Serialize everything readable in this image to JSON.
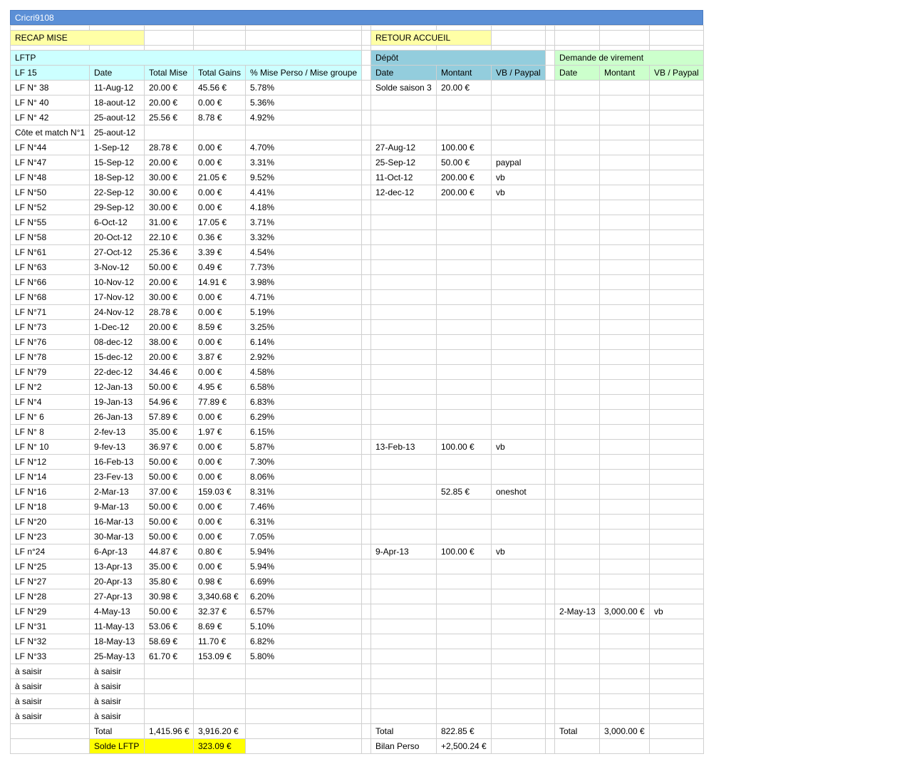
{
  "title": "Cricri9108",
  "links": {
    "recap": "RECAP MISE",
    "retour": "RETOUR ACCUEIL"
  },
  "sections": {
    "lftp": "LFTP",
    "depot": "Dépôt",
    "virement": "Demande de virement"
  },
  "headers": {
    "lftp": [
      "LF 15",
      "Date",
      "Total Mise",
      "Total Gains",
      "% Mise Perso / Mise groupe"
    ],
    "depot": [
      "Date",
      "Montant",
      "VB / Paypal"
    ],
    "virement": [
      "Date",
      "Montant",
      "VB / Paypal"
    ]
  },
  "rows": [
    {
      "lf": "LF N° 38",
      "date": "11-Aug-12",
      "mise": "20.00 €",
      "gains": "45.56 €",
      "pct": "5.78%",
      "d_date": "Solde saison 3",
      "d_mont": "20.00 €",
      "d_vb": "",
      "v_date": "",
      "v_mont": "",
      "v_vb": ""
    },
    {
      "lf": "LF N° 40",
      "date": "18-aout-12",
      "mise": "20.00 €",
      "gains": "0.00 €",
      "pct": "5.36%",
      "d_date": "",
      "d_mont": "",
      "d_vb": "",
      "v_date": "",
      "v_mont": "",
      "v_vb": ""
    },
    {
      "lf": "LF N° 42",
      "date": "25-aout-12",
      "mise": "25.56 €",
      "gains": "8.78 €",
      "pct": "4.92%",
      "d_date": "",
      "d_mont": "",
      "d_vb": "",
      "v_date": "",
      "v_mont": "",
      "v_vb": ""
    },
    {
      "lf": "Côte et match N°1",
      "date": "25-aout-12",
      "mise": "",
      "gains": "",
      "pct": "",
      "d_date": "",
      "d_mont": "",
      "d_vb": "",
      "v_date": "",
      "v_mont": "",
      "v_vb": ""
    },
    {
      "lf": "LF N°44",
      "date": "1-Sep-12",
      "mise": "28.78 €",
      "gains": "0.00 €",
      "pct": "4.70%",
      "d_date": "27-Aug-12",
      "d_mont": "100.00 €",
      "d_vb": "",
      "v_date": "",
      "v_mont": "",
      "v_vb": ""
    },
    {
      "lf": "LF N°47",
      "date": "15-Sep-12",
      "mise": "20.00 €",
      "gains": "0.00 €",
      "pct": "3.31%",
      "d_date": "25-Sep-12",
      "d_mont": "50.00 €",
      "d_vb": "paypal",
      "v_date": "",
      "v_mont": "",
      "v_vb": ""
    },
    {
      "lf": "LF N°48",
      "date": "18-Sep-12",
      "mise": "30.00 €",
      "gains": "21.05 €",
      "pct": "9.52%",
      "d_date": "11-Oct-12",
      "d_mont": "200.00 €",
      "d_vb": "vb",
      "v_date": "",
      "v_mont": "",
      "v_vb": ""
    },
    {
      "lf": "LF N°50",
      "date": "22-Sep-12",
      "mise": "30.00 €",
      "gains": "0.00 €",
      "pct": "4.41%",
      "d_date": "12-dec-12",
      "d_mont": "200.00 €",
      "d_vb": "vb",
      "v_date": "",
      "v_mont": "",
      "v_vb": ""
    },
    {
      "lf": "LF N°52",
      "date": "29-Sep-12",
      "mise": "30.00 €",
      "gains": "0.00 €",
      "pct": "4.18%",
      "d_date": "",
      "d_mont": "",
      "d_vb": "",
      "v_date": "",
      "v_mont": "",
      "v_vb": ""
    },
    {
      "lf": "LF N°55",
      "date": "6-Oct-12",
      "mise": "31.00 €",
      "gains": "17.05 €",
      "pct": "3.71%",
      "d_date": "",
      "d_mont": "",
      "d_vb": "",
      "v_date": "",
      "v_mont": "",
      "v_vb": ""
    },
    {
      "lf": "LF N°58",
      "date": "20-Oct-12",
      "mise": "22.10 €",
      "gains": "0.36 €",
      "pct": "3.32%",
      "d_date": "",
      "d_mont": "",
      "d_vb": "",
      "v_date": "",
      "v_mont": "",
      "v_vb": ""
    },
    {
      "lf": "LF N°61",
      "date": "27-Oct-12",
      "mise": "25.36 €",
      "gains": "3.39 €",
      "pct": "4.54%",
      "d_date": "",
      "d_mont": "",
      "d_vb": "",
      "v_date": "",
      "v_mont": "",
      "v_vb": ""
    },
    {
      "lf": "LF N°63",
      "date": "3-Nov-12",
      "mise": "50.00 €",
      "gains": "0.49 €",
      "pct": "7.73%",
      "d_date": "",
      "d_mont": "",
      "d_vb": "",
      "v_date": "",
      "v_mont": "",
      "v_vb": ""
    },
    {
      "lf": "LF N°66",
      "date": "10-Nov-12",
      "mise": "20.00 €",
      "gains": "14.91 €",
      "pct": "3.98%",
      "d_date": "",
      "d_mont": "",
      "d_vb": "",
      "v_date": "",
      "v_mont": "",
      "v_vb": ""
    },
    {
      "lf": "LF N°68",
      "date": "17-Nov-12",
      "mise": "30.00 €",
      "gains": "0.00 €",
      "pct": "4.71%",
      "d_date": "",
      "d_mont": "",
      "d_vb": "",
      "v_date": "",
      "v_mont": "",
      "v_vb": ""
    },
    {
      "lf": "LF N°71",
      "date": "24-Nov-12",
      "mise": "28.78 €",
      "gains": "0.00 €",
      "pct": "5.19%",
      "d_date": "",
      "d_mont": "",
      "d_vb": "",
      "v_date": "",
      "v_mont": "",
      "v_vb": ""
    },
    {
      "lf": "LF N°73",
      "date": "1-Dec-12",
      "mise": "20.00 €",
      "gains": "8.59 €",
      "pct": "3.25%",
      "d_date": "",
      "d_mont": "",
      "d_vb": "",
      "v_date": "",
      "v_mont": "",
      "v_vb": ""
    },
    {
      "lf": "LF N°76",
      "date": "08-dec-12",
      "mise": "38.00 €",
      "gains": "0.00 €",
      "pct": "6.14%",
      "d_date": "",
      "d_mont": "",
      "d_vb": "",
      "v_date": "",
      "v_mont": "",
      "v_vb": ""
    },
    {
      "lf": "LF N°78",
      "date": "15-dec-12",
      "mise": "20.00 €",
      "gains": "3.87 €",
      "pct": "2.92%",
      "d_date": "",
      "d_mont": "",
      "d_vb": "",
      "v_date": "",
      "v_mont": "",
      "v_vb": ""
    },
    {
      "lf": "LF N°79",
      "date": "22-dec-12",
      "mise": "34.46 €",
      "gains": "0.00 €",
      "pct": "4.58%",
      "d_date": "",
      "d_mont": "",
      "d_vb": "",
      "v_date": "",
      "v_mont": "",
      "v_vb": ""
    },
    {
      "lf": "LF N°2",
      "date": "12-Jan-13",
      "mise": "50.00 €",
      "gains": "4.95 €",
      "pct": "6.58%",
      "d_date": "",
      "d_mont": "",
      "d_vb": "",
      "v_date": "",
      "v_mont": "",
      "v_vb": ""
    },
    {
      "lf": "LF N°4",
      "date": "19-Jan-13",
      "mise": "54.96 €",
      "gains": "77.89 €",
      "pct": "6.83%",
      "d_date": "",
      "d_mont": "",
      "d_vb": "",
      "v_date": "",
      "v_mont": "",
      "v_vb": ""
    },
    {
      "lf": "LF N° 6",
      "date": "26-Jan-13",
      "mise": "57.89 €",
      "gains": "0.00 €",
      "pct": "6.29%",
      "d_date": "",
      "d_mont": "",
      "d_vb": "",
      "v_date": "",
      "v_mont": "",
      "v_vb": ""
    },
    {
      "lf": "LF N° 8",
      "date": "2-fev-13",
      "mise": "35.00 €",
      "gains": "1.97 €",
      "pct": "6.15%",
      "d_date": "",
      "d_mont": "",
      "d_vb": "",
      "v_date": "",
      "v_mont": "",
      "v_vb": ""
    },
    {
      "lf": "LF N° 10",
      "date": "9-fev-13",
      "mise": "36.97 €",
      "gains": "0.00 €",
      "pct": "5.87%",
      "d_date": "13-Feb-13",
      "d_mont": "100.00 €",
      "d_vb": "vb",
      "v_date": "",
      "v_mont": "",
      "v_vb": ""
    },
    {
      "lf": "LF N°12",
      "date": "16-Feb-13",
      "mise": "50.00 €",
      "gains": "0.00 €",
      "pct": "7.30%",
      "d_date": "",
      "d_mont": "",
      "d_vb": "",
      "v_date": "",
      "v_mont": "",
      "v_vb": ""
    },
    {
      "lf": "LF N°14",
      "date": "23-Fev-13",
      "mise": "50.00 €",
      "gains": "0.00 €",
      "pct": "8.06%",
      "d_date": "",
      "d_mont": "",
      "d_vb": "",
      "v_date": "",
      "v_mont": "",
      "v_vb": ""
    },
    {
      "lf": "LF N°16",
      "date": "2-Mar-13",
      "mise": "37.00 €",
      "gains": "159.03 €",
      "pct": "8.31%",
      "d_date": "",
      "d_mont": "52.85 €",
      "d_vb": "oneshot",
      "v_date": "",
      "v_mont": "",
      "v_vb": ""
    },
    {
      "lf": "LF N°18",
      "date": "9-Mar-13",
      "mise": "50.00 €",
      "gains": "0.00 €",
      "pct": "7.46%",
      "d_date": "",
      "d_mont": "",
      "d_vb": "",
      "v_date": "",
      "v_mont": "",
      "v_vb": ""
    },
    {
      "lf": "LF N°20",
      "date": "16-Mar-13",
      "mise": "50.00 €",
      "gains": "0.00 €",
      "pct": "6.31%",
      "d_date": "",
      "d_mont": "",
      "d_vb": "",
      "v_date": "",
      "v_mont": "",
      "v_vb": ""
    },
    {
      "lf": "LF N°23",
      "date": "30-Mar-13",
      "mise": "50.00 €",
      "gains": "0.00 €",
      "pct": "7.05%",
      "d_date": "",
      "d_mont": "",
      "d_vb": "",
      "v_date": "",
      "v_mont": "",
      "v_vb": ""
    },
    {
      "lf": "LF n°24",
      "date": "6-Apr-13",
      "mise": "44.87 €",
      "gains": "0.80 €",
      "pct": "5.94%",
      "d_date": "9-Apr-13",
      "d_mont": "100.00 €",
      "d_vb": "vb",
      "v_date": "",
      "v_mont": "",
      "v_vb": ""
    },
    {
      "lf": "LF N°25",
      "date": "13-Apr-13",
      "mise": "35.00 €",
      "gains": "0.00 €",
      "pct": "5.94%",
      "d_date": "",
      "d_mont": "",
      "d_vb": "",
      "v_date": "",
      "v_mont": "",
      "v_vb": ""
    },
    {
      "lf": "LF N°27",
      "date": "20-Apr-13",
      "mise": "35.80 €",
      "gains": "0.98 €",
      "pct": "6.69%",
      "d_date": "",
      "d_mont": "",
      "d_vb": "",
      "v_date": "",
      "v_mont": "",
      "v_vb": ""
    },
    {
      "lf": "LF N°28",
      "date": "27-Apr-13",
      "mise": "30.98 €",
      "gains": "3,340.68 €",
      "pct": "6.20%",
      "d_date": "",
      "d_mont": "",
      "d_vb": "",
      "v_date": "",
      "v_mont": "",
      "v_vb": ""
    },
    {
      "lf": "LF N°29",
      "date": "4-May-13",
      "mise": "50.00 €",
      "gains": "32.37 €",
      "pct": "6.57%",
      "d_date": "",
      "d_mont": "",
      "d_vb": "",
      "v_date": "2-May-13",
      "v_mont": "3,000.00 €",
      "v_vb": "vb"
    },
    {
      "lf": "LF N°31",
      "date": "11-May-13",
      "mise": "53.06 €",
      "gains": "8.69 €",
      "pct": "5.10%",
      "d_date": "",
      "d_mont": "",
      "d_vb": "",
      "v_date": "",
      "v_mont": "",
      "v_vb": ""
    },
    {
      "lf": "LF N°32",
      "date": "18-May-13",
      "mise": "58.69 €",
      "gains": "11.70 €",
      "pct": "6.82%",
      "d_date": "",
      "d_mont": "",
      "d_vb": "",
      "v_date": "",
      "v_mont": "",
      "v_vb": ""
    },
    {
      "lf": "LF N°33",
      "date": "25-May-13",
      "mise": "61.70 €",
      "gains": "153.09 €",
      "pct": "5.80%",
      "d_date": "",
      "d_mont": "",
      "d_vb": "",
      "v_date": "",
      "v_mont": "",
      "v_vb": ""
    },
    {
      "lf": "à saisir",
      "date": "à saisir",
      "mise": "",
      "gains": "",
      "pct": "",
      "d_date": "",
      "d_mont": "",
      "d_vb": "",
      "v_date": "",
      "v_mont": "",
      "v_vb": ""
    },
    {
      "lf": "à saisir",
      "date": "à saisir",
      "mise": "",
      "gains": "",
      "pct": "",
      "d_date": "",
      "d_mont": "",
      "d_vb": "",
      "v_date": "",
      "v_mont": "",
      "v_vb": ""
    },
    {
      "lf": "à saisir",
      "date": "à saisir",
      "mise": "",
      "gains": "",
      "pct": "",
      "d_date": "",
      "d_mont": "",
      "d_vb": "",
      "v_date": "",
      "v_mont": "",
      "v_vb": ""
    },
    {
      "lf": "à saisir",
      "date": "à saisir",
      "mise": "",
      "gains": "",
      "pct": "",
      "d_date": "",
      "d_mont": "",
      "d_vb": "",
      "v_date": "",
      "v_mont": "",
      "v_vb": ""
    }
  ],
  "totals": {
    "label": "Total",
    "mise": "1,415.96 €",
    "gains": "3,916.20 €",
    "depot_label": "Total",
    "depot_mont": "822.85 €",
    "vir_label": "Total",
    "vir_mont": "3,000.00 €"
  },
  "solde": {
    "label": "Solde LFTP",
    "value": "323.09 €",
    "bilan_label": "Bilan Perso",
    "bilan_value": "+2,500.24 €"
  },
  "colors": {
    "title_bar": "#5b8fd6",
    "yellow": "#ffffa6",
    "cyan": "#ccffff",
    "blue": "#93cddd",
    "green": "#ccffcc",
    "bright_yellow": "#ffff00"
  }
}
